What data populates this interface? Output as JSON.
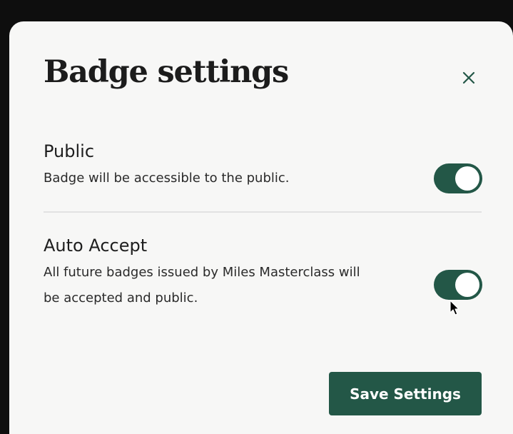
{
  "modal": {
    "title": "Badge settings",
    "close_icon": "close-icon",
    "settings": [
      {
        "title": "Public",
        "description": "Badge will be accessible to the public.",
        "enabled": true
      },
      {
        "title": "Auto Accept",
        "description_lines": [
          "All future badges issued by Miles Masterclass will",
          "be accepted and public."
        ],
        "enabled": true
      }
    ],
    "save_label": "Save Settings"
  },
  "colors": {
    "accent": "#235747",
    "background": "#f7f7f6",
    "backdrop": "#0e0e0e",
    "text": "#1c1c1c"
  }
}
